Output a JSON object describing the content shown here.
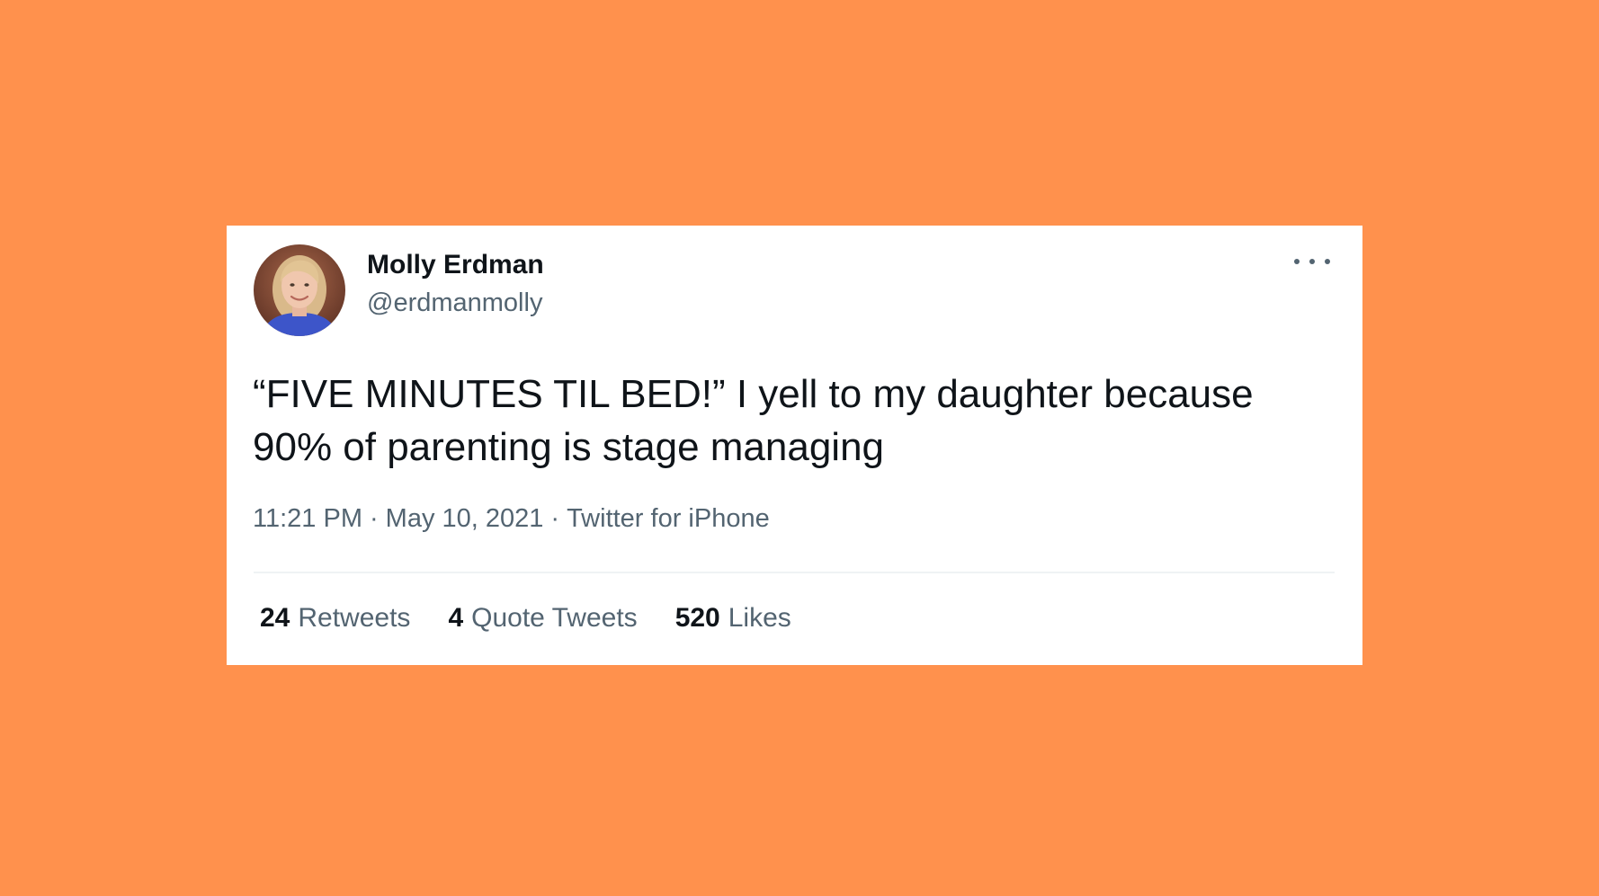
{
  "colors": {
    "background": "#FF914D",
    "card": "#FFFFFF",
    "primary_text": "#0F1419",
    "secondary_text": "#536471",
    "divider": "#EFF3F4"
  },
  "tweet": {
    "author": {
      "name": "Molly Erdman",
      "handle": "@erdmanmolly",
      "avatar": "profile-photo"
    },
    "more_icon": "more-horizontal-icon",
    "text": "“FIVE MINUTES TIL BED!” I yell to my daughter because 90% of parenting is stage managing",
    "time": "11:21 PM",
    "date": "May 10, 2021",
    "source": "Twitter for iPhone",
    "separator": "·",
    "stats": [
      {
        "count": "24",
        "label": "Retweets"
      },
      {
        "count": "4",
        "label": "Quote Tweets"
      },
      {
        "count": "520",
        "label": "Likes"
      }
    ]
  }
}
